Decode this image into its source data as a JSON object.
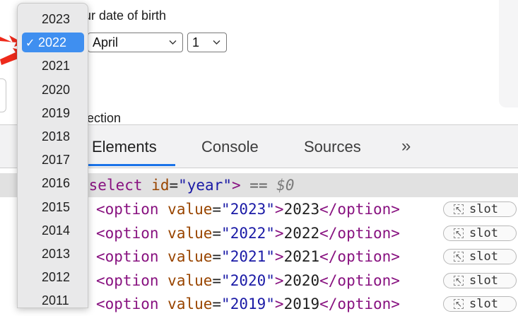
{
  "form": {
    "dob_label": "ur date of birth",
    "month_value": "April",
    "day_value": "1",
    "section_label": "ection"
  },
  "year_dropdown": {
    "items": [
      "2023",
      "2022",
      "2021",
      "2020",
      "2019",
      "2018",
      "2017",
      "2016",
      "2015",
      "2014",
      "2013",
      "2012",
      "2011"
    ],
    "selected": "2022",
    "check_glyph": "✓"
  },
  "devtools": {
    "tabs": [
      "Elements",
      "Console",
      "Sources"
    ],
    "active_tab": "Elements",
    "overflow_glyph": "»",
    "selected_node": {
      "open": "select",
      "attr_name": "id",
      "attr_value": "\"year\"",
      "close": ">",
      "marker": "==",
      "var": "$0"
    },
    "option_lines": [
      {
        "value": "\"2023\"",
        "text": "2023"
      },
      {
        "value": "\"2022\"",
        "text": "2022"
      },
      {
        "value": "\"2021\"",
        "text": "2021"
      },
      {
        "value": "\"2020\"",
        "text": "2020"
      },
      {
        "value": "\"2019\"",
        "text": "2019"
      }
    ],
    "slot_label": "slot"
  },
  "colors": {
    "accent": "#3f8ff0",
    "arrow": "#ee2a1b",
    "tab_underline": "#1a73e8"
  }
}
